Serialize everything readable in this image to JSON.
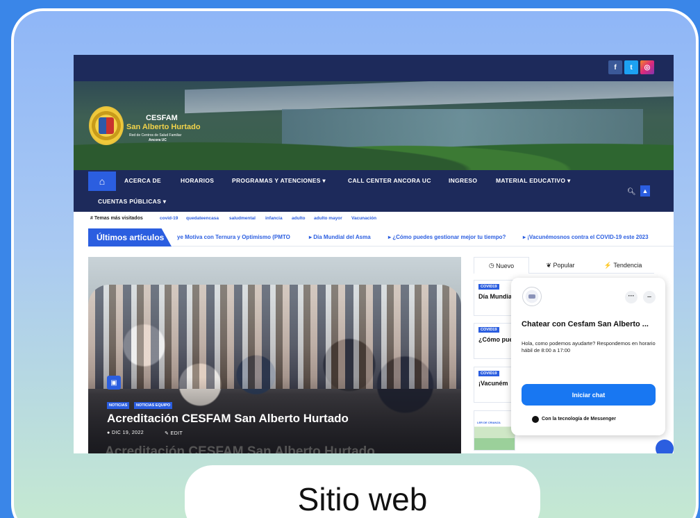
{
  "colors": {
    "background": "#3a86e8",
    "navy": "#1d2a5b",
    "accent": "#2b5ee0",
    "messenger": "#1877f2"
  },
  "social": [
    {
      "icon": "facebook-icon",
      "glyph": "f",
      "color": "#3b5998"
    },
    {
      "icon": "twitter-icon",
      "glyph": "t",
      "color": "#1da1f2"
    },
    {
      "icon": "instagram-icon",
      "glyph": "◎",
      "color": "#e1306c"
    }
  ],
  "brand": {
    "line1": "CESFAM",
    "line2": "San Alberto Hurtado",
    "line3": "Red de Centros de Salud Familiar",
    "line4": "Ancora UC"
  },
  "nav": {
    "home_icon": "⌂",
    "items": [
      "ACERCA DE",
      "HORARIOS",
      "PROGRAMAS Y ATENCIONES ▾",
      "CALL CENTER ANCORA UC",
      "INGRESO",
      "MATERIAL EDUCATIVO ▾"
    ],
    "second_row": "CUENTAS PÚBLICAS ▾"
  },
  "topics": {
    "label": "# Temas más visitados",
    "tags": [
      "covid-19",
      "quedateencasa",
      "saludmental",
      "infancia",
      "adulto",
      "adulto mayor",
      "Vacunación"
    ]
  },
  "ticker": {
    "label": "Últimos artículos",
    "items": [
      "ye Motiva con Ternura y Optimismo (PMTO",
      "Día Mundial del Asma",
      "¿Cómo puedes gestionar mejor tu tiempo?",
      "¡Vacunémosnos contra el COVID-19 este 2023"
    ]
  },
  "featured": {
    "categories": [
      "NOTICIAS",
      "NOTICIAS EQUIPO"
    ],
    "title": "Acreditación CESFAM San Alberto Hurtado",
    "date": "DIC 19, 2022",
    "edit": "EDIT",
    "ghost_title": "Acreditación CESFAM San Alberto Hurtado"
  },
  "sidebar": {
    "tabs": [
      "Nuevo",
      "Popular",
      "Tendencia"
    ],
    "posts": [
      {
        "category": "COVID19",
        "title": "Día Mundia"
      },
      {
        "category": "COVID19",
        "title": "¿Cómo pue"
      },
      {
        "category": "COVID19",
        "title": "¡Vacuném"
      }
    ],
    "thumb_text": "LER DE CRIANZA"
  },
  "chat": {
    "title": "Chatear con Cesfam San Alberto ...",
    "message": "Hola, como podemos ayudarte? Respondemos en horario hábil de 8:00 a 17:00",
    "button": "Iniciar chat",
    "powered": "Con la tecnología de Messenger",
    "more": "···",
    "minimize": "–"
  },
  "caption": "Sitio web"
}
